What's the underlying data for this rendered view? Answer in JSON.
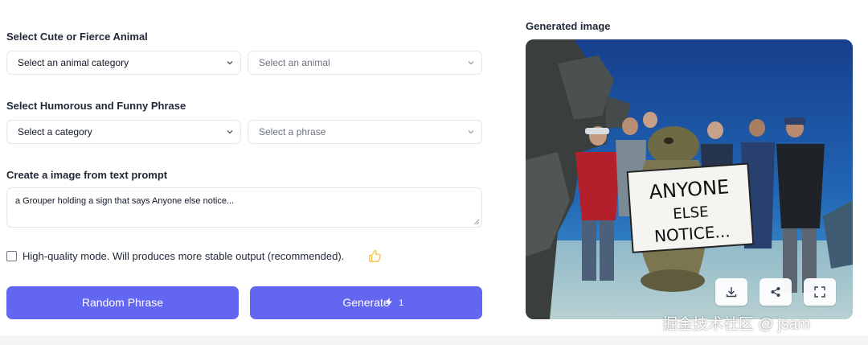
{
  "animal_section": {
    "label": "Select Cute or Fierce Animal",
    "category_select": "Select an animal category",
    "animal_select": "Select an animal"
  },
  "phrase_section": {
    "label": "Select Humorous and Funny Phrase",
    "category_select": "Select a category",
    "phrase_select": "Select a phrase"
  },
  "prompt_section": {
    "label": "Create a image from text prompt",
    "prompt_value": "a Grouper holding a sign that says Anyone else notice..."
  },
  "quality": {
    "label": "High-quality mode. Will produces more stable output (recommended).",
    "checked": false
  },
  "buttons": {
    "random_phrase": "Random Phrase",
    "generate": "Generate",
    "generate_credits": "1"
  },
  "output": {
    "title": "Generated image",
    "sign_lines": [
      "ANYONE",
      "ELSE",
      "NOTICE..."
    ],
    "actions": [
      "download-icon",
      "share-icon",
      "fullscreen-icon"
    ]
  },
  "watermark": "掘金技术社区 @ jsam",
  "colors": {
    "accent": "#6366f1",
    "water": "#1e4f9a",
    "thumb": "#f5c542"
  }
}
